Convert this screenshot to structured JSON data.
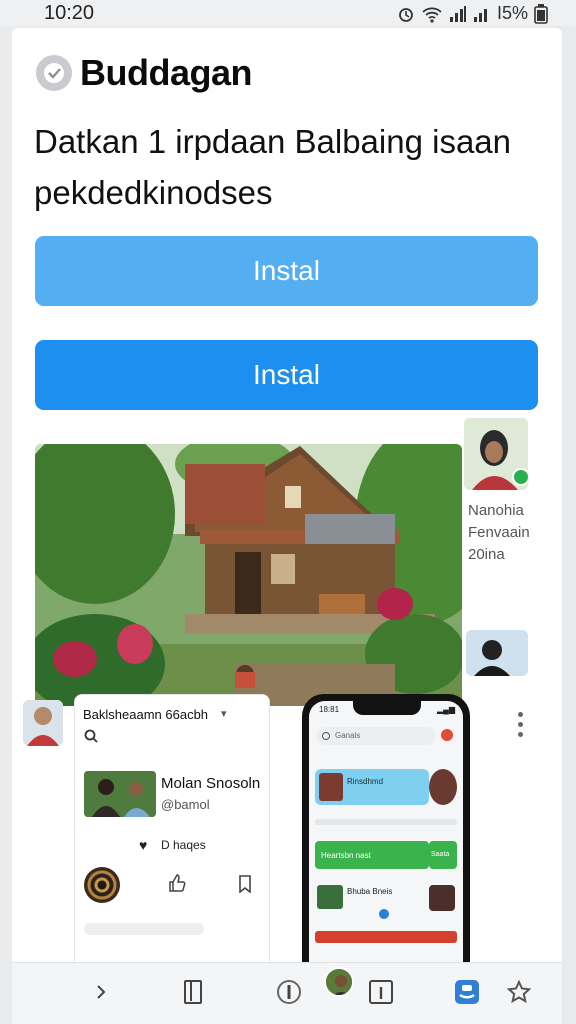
{
  "status_bar": {
    "time": "10:20",
    "battery_text": "I5%"
  },
  "header": {
    "app_name": "Buddagan"
  },
  "headline": {
    "line1": "Datkan 1 irpdaan Balbaing isaan",
    "line2": "pekdedkinodses"
  },
  "buttons": {
    "primary_label": "Instal",
    "secondary_label": "Instal"
  },
  "side_card": {
    "line1": "Nanohia",
    "line2": "Fenvaain",
    "line3": "20ina"
  },
  "feed_card": {
    "title": "Baklsheaamn 66acbh",
    "user_name": "Molan Snosoln",
    "user_handle": "@bamol",
    "tag": "D haqes"
  },
  "phone_preview": {
    "time": "18:81",
    "search_placeholder": "Ganals",
    "row1_text": "Rinsdhmd",
    "green_text": "Heartsbn nast",
    "green_side": "Saata",
    "row3_text": "Bhuba Bneis"
  },
  "colors": {
    "button_light": "#53aef2",
    "button_dark": "#1d8ff0",
    "accent_green": "#29b04a"
  },
  "icons": {
    "bottom_nav": [
      "chevron-right-icon",
      "bookmark-icon",
      "compass-icon",
      "profile-icon",
      "info-icon",
      "chat-icon",
      "star-icon"
    ]
  }
}
